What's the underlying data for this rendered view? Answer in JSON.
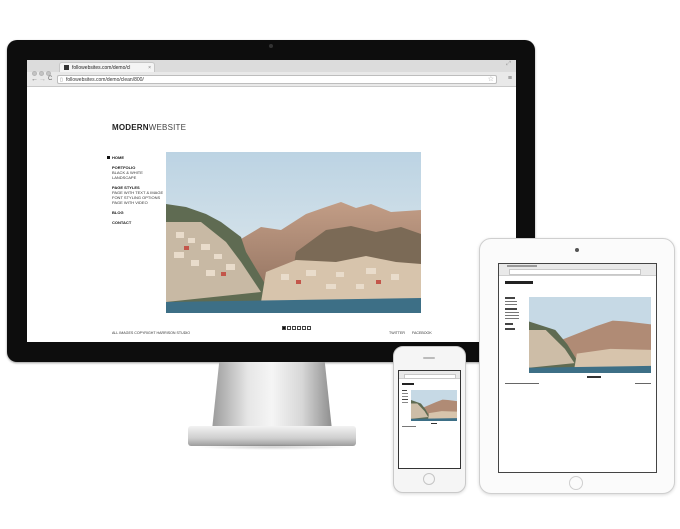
{
  "browser": {
    "tab_title": "followebsites.com/demo/cl",
    "tab_close": "×",
    "url": "followebsites.com/demo/clean/800/",
    "back": "←",
    "forward": "→",
    "reload": "C",
    "star": "☆",
    "menu": "≡",
    "resize": "⤢"
  },
  "site": {
    "logo_bold": "MODERN",
    "logo_light": "WEBSITE",
    "nav": {
      "home": "HOME",
      "portfolio": "PORTFOLIO",
      "black_white": "BLACK & WHITE",
      "landscape": "LANDSCAPE",
      "page_styles": "PAGE STYLES",
      "page_text_image": "PAGE WITH TEXT & IMAGE",
      "font_styling": "FONT STYLING OPTIONS",
      "page_video": "PAGE WITH VIDEO",
      "blog": "BLOG",
      "contact": "CONTACT"
    },
    "footer": {
      "copyright": "ALL IMAGES COPYRIGHT HARRISON STUDIO",
      "twitter": "TWITTER",
      "facebook": "FACEBOOK"
    },
    "slides": {
      "count": 6,
      "active": 0
    }
  },
  "colors": {
    "imac_bezel": "#0d0d0d",
    "sky": "#c9dce8",
    "mountain": "#b58a74",
    "sea": "#3d6f86"
  },
  "icons": [
    "back-arrow-icon",
    "forward-arrow-icon",
    "reload-icon",
    "page-icon",
    "star-icon",
    "menu-icon",
    "favicon-icon",
    "resize-icon"
  ]
}
